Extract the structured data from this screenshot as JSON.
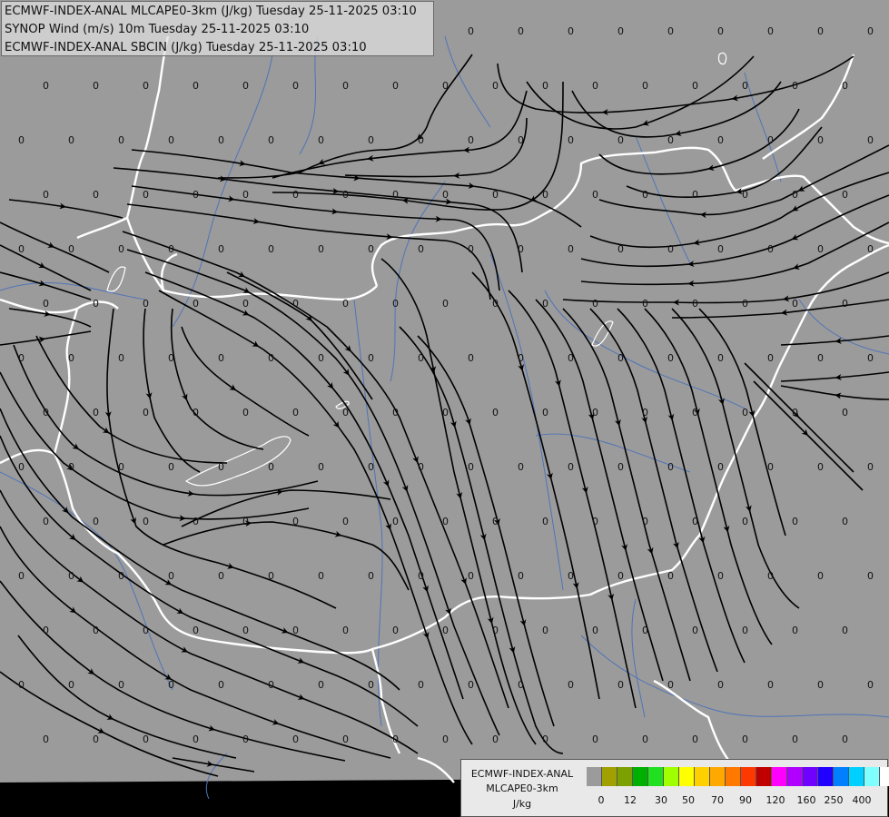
{
  "header": {
    "line1": "ECMWF-INDEX-ANAL MLCAPE0-3km (J/kg) Tuesday 25-11-2025 03:10",
    "line2": "SYNOP Wind (m/s) 10m Tuesday 25-11-2025 03:10",
    "line3": "ECMWF-INDEX-ANAL SBCIN (J/kg) Tuesday 25-11-2025 03:10"
  },
  "map": {
    "station_value": "0",
    "background_color": "#9b9b9b",
    "border_color": "#ffffff",
    "river_color": "#4f74b8",
    "streamline_color": "#000000",
    "streamline_direction": "west-north-westward flow over northern area, turning southward and north-westward in the south"
  },
  "legend": {
    "title_line1": "ECMWF-INDEX-ANAL",
    "title_line2": "MLCAPE0-3km",
    "unit": "J/kg",
    "colors": [
      "#9b9b9b",
      "#a0a000",
      "#7ca000",
      "#00b000",
      "#20e020",
      "#a0ff00",
      "#ffff00",
      "#ffd000",
      "#ffa800",
      "#ff7800",
      "#ff3800",
      "#c00000",
      "#ff00ff",
      "#b000ff",
      "#7000ff",
      "#2000ff",
      "#0080ff",
      "#00d0ff",
      "#80ffff",
      "#ffffff"
    ],
    "ticks": [
      "0",
      "12",
      "30",
      "50",
      "70",
      "90",
      "120",
      "160",
      "250",
      "400"
    ]
  }
}
